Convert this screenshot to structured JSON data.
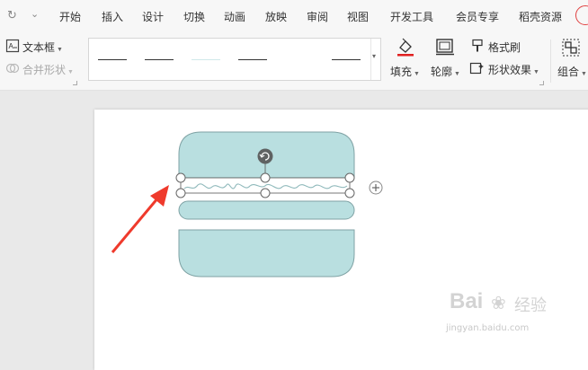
{
  "menu": {
    "tabs": [
      "开始",
      "插入",
      "设计",
      "切换",
      "动画",
      "放映",
      "审阅",
      "视图",
      "开发工具",
      "会员专享",
      "稻壳资源"
    ]
  },
  "ribbon": {
    "textbox_label": "文本框",
    "merge_shapes_label": "合并形状",
    "fill_label": "填充",
    "outline_label": "轮廓",
    "format_painter_label": "格式刷",
    "shape_effects_label": "形状效果",
    "group_label": "组合",
    "fill_color": "#e02020"
  },
  "canvas": {
    "shape_fill": "#b9dfe0",
    "shape_stroke": "#7fa2a4",
    "arrow_color": "#ef3a2c"
  },
  "watermark": {
    "brand": "Bai",
    "brand2": "经验",
    "url": "jingyan.baidu.com"
  }
}
